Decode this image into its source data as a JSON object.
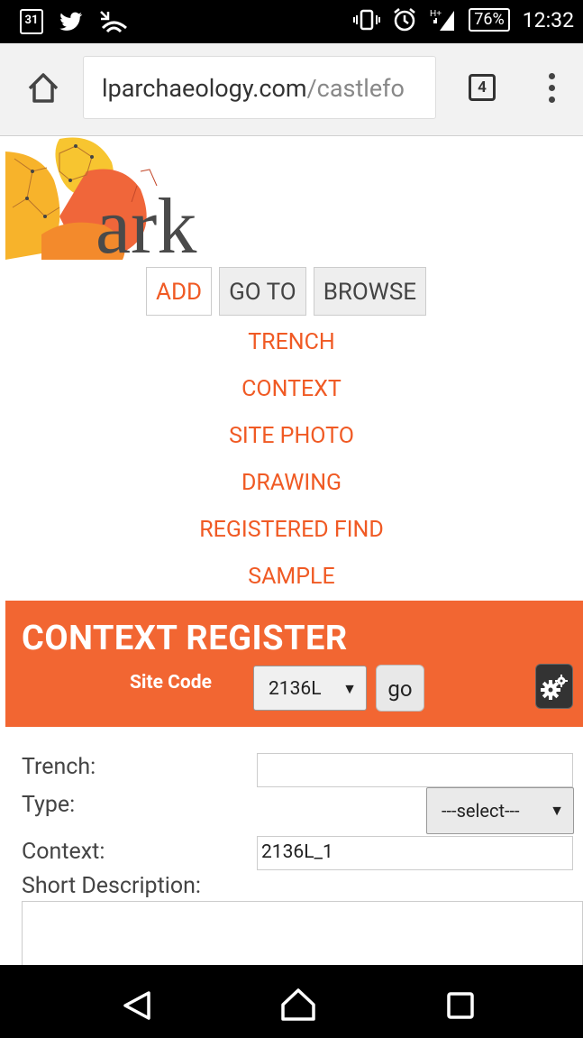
{
  "status_bar": {
    "calendar_day": "31",
    "battery": "76%",
    "time": "12:32"
  },
  "browser": {
    "url_host": "lparchaeology.com",
    "url_path": "/castlefo",
    "tab_count": "4"
  },
  "logo_text": "ark",
  "nav_tabs": [
    "ADD",
    "GO TO",
    "BROWSE"
  ],
  "submenu": [
    "TRENCH",
    "CONTEXT",
    "SITE PHOTO",
    "DRAWING",
    "REGISTERED FIND",
    "SAMPLE"
  ],
  "register": {
    "title": "CONTEXT REGISTER",
    "site_code_label": "Site Code",
    "site_code_value": "2136L",
    "go_label": "go"
  },
  "form": {
    "trench_label": "Trench:",
    "trench_value": "",
    "type_label": "Type:",
    "type_value": "---select---",
    "context_label": "Context:",
    "context_value": "2136L_1",
    "short_desc_label": "Short Description:",
    "short_desc_value": ""
  },
  "colors": {
    "accent": "#f05a24",
    "register_bg": "#f26632"
  }
}
